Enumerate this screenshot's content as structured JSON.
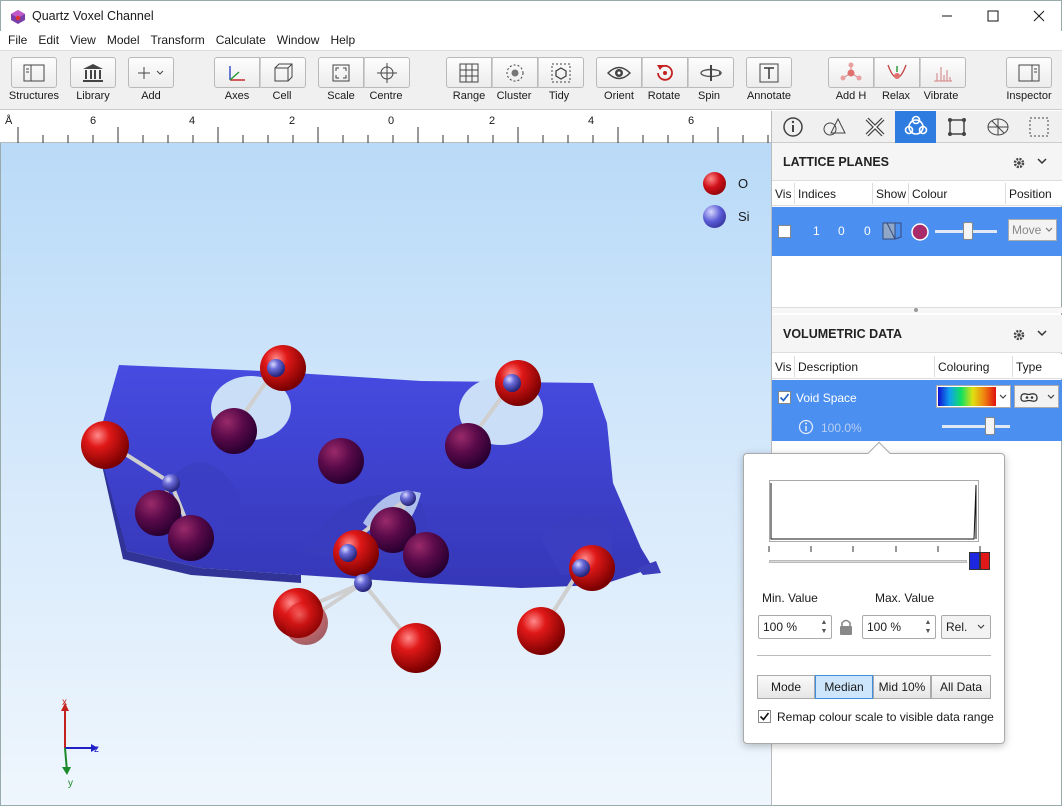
{
  "window": {
    "title": "Quartz Voxel Channel"
  },
  "menu": [
    "File",
    "Edit",
    "View",
    "Model",
    "Transform",
    "Calculate",
    "Window",
    "Help"
  ],
  "toolbar": {
    "structures": "Structures",
    "library": "Library",
    "add": "Add",
    "axes": "Axes",
    "cell": "Cell",
    "scale": "Scale",
    "centre": "Centre",
    "range": "Range",
    "cluster": "Cluster",
    "tidy": "Tidy",
    "orient": "Orient",
    "rotate": "Rotate",
    "spin": "Spin",
    "annotate": "Annotate",
    "addh": "Add H",
    "relax": "Relax",
    "vibrate": "Vibrate",
    "inspector": "Inspector"
  },
  "ruler": {
    "unit": "Å",
    "ticks": [
      "6",
      "4",
      "2",
      "0",
      "2",
      "4",
      "6"
    ]
  },
  "legend": [
    {
      "label": "O",
      "color": "#d0101a"
    },
    {
      "label": "Si",
      "color": "#5a5ad6"
    }
  ],
  "axes_labels": {
    "x": "x",
    "y": "y",
    "z": "z"
  },
  "lattice": {
    "title": "LATTICE PLANES",
    "columns": [
      "Vis",
      "Indices",
      "Show",
      "Colour",
      "Position"
    ],
    "row": {
      "h": "1",
      "k": "0",
      "l": "0",
      "position": "Move"
    }
  },
  "volumetric": {
    "title": "VOLUMETRIC DATA",
    "columns": [
      "Vis",
      "Description",
      "Colouring",
      "Type"
    ],
    "row": {
      "description": "Void Space",
      "percent": "100.0%"
    }
  },
  "popup": {
    "min_label": "Min. Value",
    "max_label": "Max. Value",
    "min_value": "100 %",
    "max_value": "100 %",
    "rel": "Rel.",
    "mode": "Mode",
    "modes": [
      "Median",
      "Mid 10%",
      "All Data"
    ],
    "remap": "Remap colour scale to visible data range"
  }
}
